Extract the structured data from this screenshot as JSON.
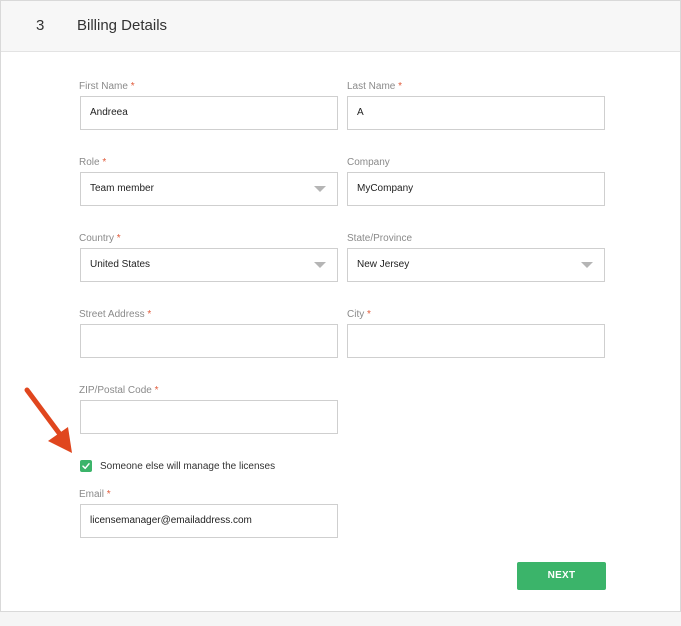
{
  "header": {
    "step_number": "3",
    "title": "Billing Details"
  },
  "form": {
    "first_name": {
      "label": "First Name",
      "required": "*",
      "value": "Andreea"
    },
    "last_name": {
      "label": "Last Name",
      "required": "*",
      "value": "A"
    },
    "role": {
      "label": "Role",
      "required": "*",
      "value": "Team member"
    },
    "company": {
      "label": "Company",
      "value": "MyCompany"
    },
    "country": {
      "label": "Country",
      "required": "*",
      "value": "United States"
    },
    "state": {
      "label": "State/Province",
      "value": "New Jersey"
    },
    "street": {
      "label": "Street Address",
      "required": "*",
      "value": ""
    },
    "city": {
      "label": "City",
      "required": "*",
      "value": ""
    },
    "zip": {
      "label": "ZIP/Postal Code",
      "required": "*",
      "value": ""
    },
    "manage_checkbox": {
      "label": "Someone else will manage the licenses",
      "checked": true
    },
    "email": {
      "label": "Email",
      "required": "*",
      "value": "licensemanager@emailaddress.com"
    }
  },
  "buttons": {
    "next_label": "NEXT"
  },
  "colors": {
    "accent": "#3bb46a",
    "required": "#e05a3a",
    "arrow": "#e0461e"
  },
  "icons": {
    "checkbox": "check-icon",
    "dropdown": "caret-down-icon",
    "annotation": "red-arrow-icon"
  }
}
